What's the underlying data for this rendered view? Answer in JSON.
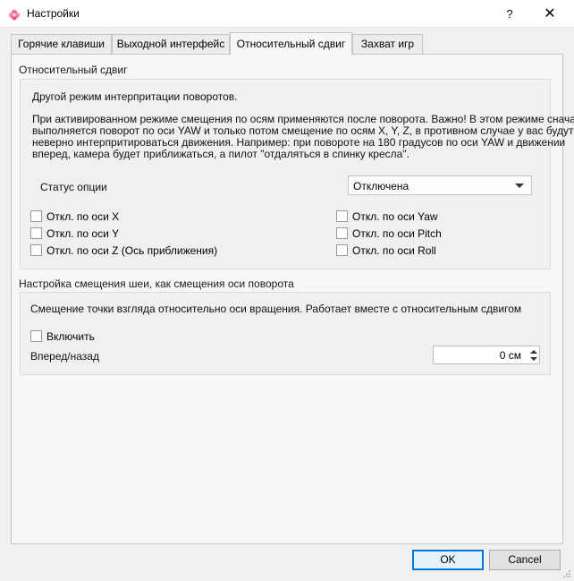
{
  "window": {
    "title": "Настройки",
    "help_label": "?",
    "close_label": "✕",
    "icon": "pink-flower-icon"
  },
  "tabs": [
    {
      "label": "Горячие клавиши"
    },
    {
      "label": "Выходной интерфейс"
    },
    {
      "label": "Относительный сдвиг",
      "active": true
    },
    {
      "label": "Захват игр"
    }
  ],
  "relative_shift": {
    "group_title": "Относительный сдвиг",
    "intro": "Другой режим интерпритации поворотов.",
    "description_lines": [
      "При активированном режиме смещения по осям применяются после поворота. Важно! В этом режиме сначала",
      "выполняется поворот по оси YAW и только потом смещение по осям X, Y, Z, в противном случае у вас будут",
      "неверно интерпритироваться движения. Например: при повороте на 180 градусов по оси YAW и движении",
      "вперед, камера будет приближаться, а пилот \"отдаляться в спинку кресла\"."
    ],
    "status_label": "Статус опции",
    "status_value": "Отключена",
    "checkboxes_left": [
      {
        "label": "Откл. по оси X",
        "checked": false
      },
      {
        "label": "Откл. по оси Y",
        "checked": false
      },
      {
        "label": "Откл. по оси Z (Ось приближения)",
        "checked": false
      }
    ],
    "checkboxes_right": [
      {
        "label": "Откл. по оси Yaw",
        "checked": false
      },
      {
        "label": "Откл. по оси Pitch",
        "checked": false
      },
      {
        "label": "Откл. по оси Roll",
        "checked": false
      }
    ]
  },
  "neck_shift": {
    "group_title": "Настройка смещения шеи, как смещения оси поворота",
    "description": "Смещение точки взгляда относительно оси вращения. Работает вместе с относительным сдвигом",
    "enable_label": "Включить",
    "enable_checked": false,
    "forward_back_label": "Вперед/назад",
    "forward_back_value": "0 см"
  },
  "buttons": {
    "ok": "OK",
    "cancel": "Cancel"
  },
  "colors": {
    "accent": "#0078d7",
    "window_bg": "#f0f0f0"
  }
}
